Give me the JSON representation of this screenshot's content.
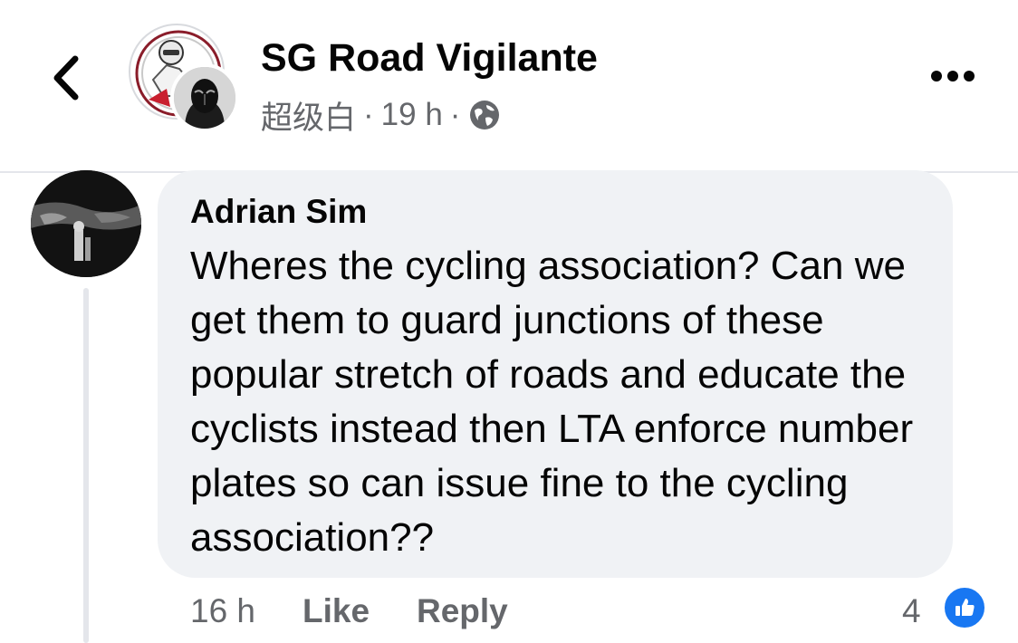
{
  "header": {
    "group_name": "SG Road Vigilante",
    "poster_name": "超级白",
    "separator": "·",
    "post_time": "19 h",
    "privacy_icon": "globe-icon",
    "back_icon": "chevron-left-icon",
    "more_icon": "more-horizontal-icon"
  },
  "comment": {
    "author": "Adrian Sim",
    "text": "Wheres the cycling association? Can we get them to guard junctions of these popular stretch of roads and educate the cyclists instead then LTA enforce number plates so can issue fine to the cycling association??",
    "time": "16 h",
    "like_label": "Like",
    "reply_label": "Reply",
    "reaction_count": "4",
    "reaction_icon": "thumbs-up-icon"
  },
  "colors": {
    "bubble_bg": "#f0f2f5",
    "secondary_text": "#65676b",
    "like_blue": "#1877f2"
  }
}
